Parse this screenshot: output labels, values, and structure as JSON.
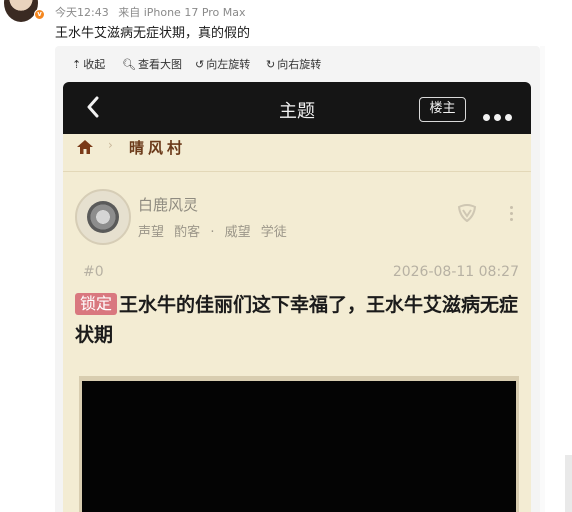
{
  "post": {
    "time": "今天12:43",
    "source": "来自 iPhone 17 Pro Max",
    "text": "王水牛艾滋病无症状期，真的假的"
  },
  "toolbar": {
    "collapse": "收起",
    "view_large": "查看大图",
    "rotate_left": "向左旋转",
    "rotate_right": "向右旋转"
  },
  "forum": {
    "header_title": "主题",
    "owner_button": "楼主",
    "breadcrumb": "晴风村",
    "author": {
      "name": "白鹿风灵",
      "reputation_label": "声望",
      "reputation_value": "酌客",
      "prestige_label": "威望",
      "prestige_value": "学徒"
    },
    "floor": "#0",
    "date": "2026-08-11 08:27",
    "lock_badge": "锁定",
    "title": "王水牛的佳丽们这下幸福了，王水牛艾滋病无症状期"
  },
  "colors": {
    "topbar": "#151515",
    "page_bg": "#f3ecd3",
    "lock_badge": "#d9787f",
    "crumb_text": "#6b3a1a"
  }
}
